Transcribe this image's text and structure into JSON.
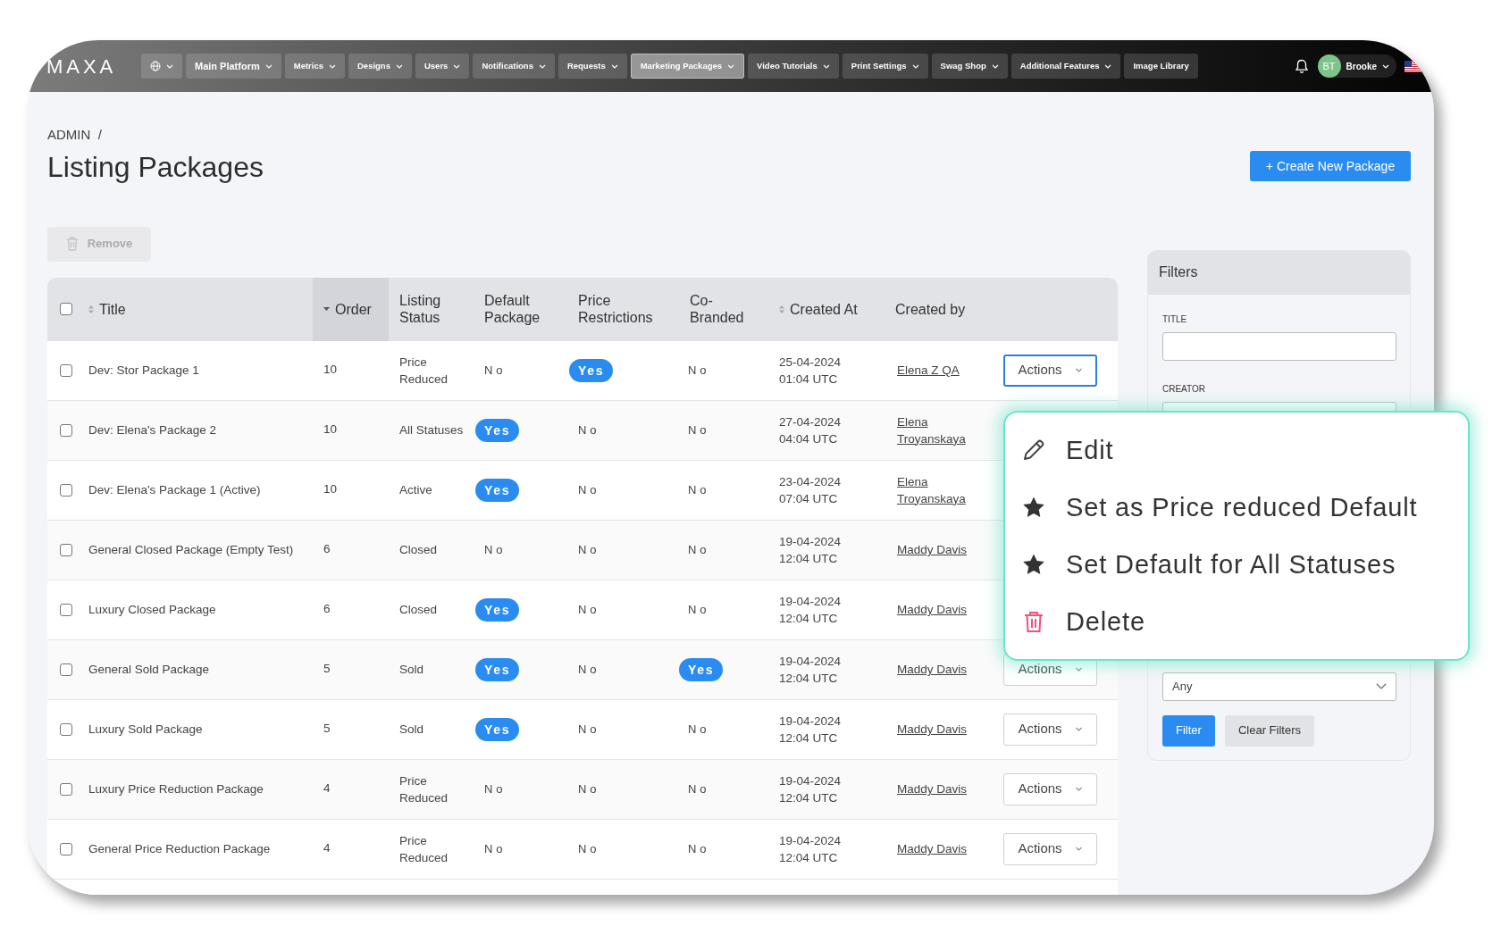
{
  "nav": {
    "logo": "MAXA",
    "items": [
      {
        "kind": "globe",
        "selected": false
      },
      {
        "kind": "menu",
        "label": "Main Platform",
        "selected": false,
        "large": true
      },
      {
        "kind": "menu",
        "label": "Metrics",
        "selected": false
      },
      {
        "kind": "menu",
        "label": "Designs",
        "selected": false
      },
      {
        "kind": "menu",
        "label": "Users",
        "selected": false
      },
      {
        "kind": "menu",
        "label": "Notifications",
        "selected": false
      },
      {
        "kind": "menu",
        "label": "Requests",
        "selected": false
      },
      {
        "kind": "menu",
        "label": "Marketing Packages",
        "selected": true
      },
      {
        "kind": "menu",
        "label": "Video Tutorials",
        "selected": false
      },
      {
        "kind": "menu",
        "label": "Print Settings",
        "selected": false
      },
      {
        "kind": "menu",
        "label": "Swag Shop",
        "selected": false
      },
      {
        "kind": "menu",
        "label": "Additional Features",
        "selected": false
      },
      {
        "kind": "link",
        "label": "Image Library",
        "selected": false
      }
    ],
    "user": {
      "initials": "BT",
      "name": "Brooke"
    }
  },
  "breadcrumb": "ADMIN  /",
  "title": "Listing Packages",
  "create_button": "+ Create New Package",
  "remove_button": {
    "label": "Remove",
    "disabled": true
  },
  "table": {
    "all_checked": false,
    "columns": [
      {
        "label": "Title",
        "sortable": true,
        "sorted": false
      },
      {
        "label": "Order",
        "sortable": true,
        "sorted": true
      },
      {
        "label": "Listing Status",
        "sortable": false,
        "sorted": false
      },
      {
        "label": "Default Package",
        "sortable": false,
        "sorted": false
      },
      {
        "label": "Price Restrictions",
        "sortable": false,
        "sorted": false
      },
      {
        "label": "Co-Branded",
        "sortable": false,
        "sorted": false
      },
      {
        "label": "Created At",
        "sortable": true,
        "sorted": false
      },
      {
        "label": "Created by",
        "sortable": false,
        "sorted": false
      }
    ],
    "rows": [
      {
        "checked": false,
        "title": "Dev: Stor Package 1",
        "order": "10",
        "status": "Price Reduced",
        "default": {
          "text": "No",
          "pill": false
        },
        "price": {
          "text": "Yes",
          "pill": true
        },
        "cobranded": {
          "text": "No",
          "pill": false
        },
        "created_at": "25-04-2024 01:04 UTC",
        "created_by": "Elena Z QA",
        "actions": {
          "label": "Actions",
          "open": true
        }
      },
      {
        "checked": false,
        "title": "Dev: Elena's Package 2",
        "order": "10",
        "status": "All Statuses",
        "default": {
          "text": "Yes",
          "pill": true
        },
        "price": {
          "text": "No",
          "pill": false
        },
        "cobranded": {
          "text": "No",
          "pill": false
        },
        "created_at": "27-04-2024 04:04 UTC",
        "created_by": "Elena Troyanskaya"
      },
      {
        "checked": false,
        "title": "Dev: Elena's Package 1 (Active)",
        "order": "10",
        "status": "Active",
        "default": {
          "text": "Yes",
          "pill": true
        },
        "price": {
          "text": "No",
          "pill": false
        },
        "cobranded": {
          "text": "No",
          "pill": false
        },
        "created_at": "23-04-2024 07:04 UTC",
        "created_by": "Elena Troyanskaya"
      },
      {
        "checked": false,
        "title": "General Closed Package (Empty Test)",
        "order": "6",
        "status": "Closed",
        "default": {
          "text": "No",
          "pill": false
        },
        "price": {
          "text": "No",
          "pill": false
        },
        "cobranded": {
          "text": "No",
          "pill": false
        },
        "created_at": "19-04-2024 12:04 UTC",
        "created_by": "Maddy Davis"
      },
      {
        "checked": false,
        "title": "Luxury Closed Package",
        "order": "6",
        "status": "Closed",
        "default": {
          "text": "Yes",
          "pill": true
        },
        "price": {
          "text": "No",
          "pill": false
        },
        "cobranded": {
          "text": "No",
          "pill": false
        },
        "created_at": "19-04-2024 12:04 UTC",
        "created_by": "Maddy Davis"
      },
      {
        "checked": false,
        "title": "General Sold Package",
        "order": "5",
        "status": "Sold",
        "default": {
          "text": "Yes",
          "pill": true
        },
        "price": {
          "text": "No",
          "pill": false
        },
        "cobranded": {
          "text": "Yes",
          "pill": true
        },
        "created_at": "19-04-2024 12:04 UTC",
        "created_by": "Maddy Davis",
        "actions": {
          "label": "Actions",
          "open": false
        }
      },
      {
        "checked": false,
        "title": "Luxury Sold Package",
        "order": "5",
        "status": "Sold",
        "default": {
          "text": "Yes",
          "pill": true
        },
        "price": {
          "text": "No",
          "pill": false
        },
        "cobranded": {
          "text": "No",
          "pill": false
        },
        "created_at": "19-04-2024 12:04 UTC",
        "created_by": "Maddy Davis",
        "actions": {
          "label": "Actions",
          "open": false
        }
      },
      {
        "checked": false,
        "title": "Luxury Price Reduction Package",
        "order": "4",
        "status": "Price Reduced",
        "default": {
          "text": "No",
          "pill": false
        },
        "price": {
          "text": "No",
          "pill": false
        },
        "cobranded": {
          "text": "No",
          "pill": false
        },
        "created_at": "19-04-2024 12:04 UTC",
        "created_by": "Maddy Davis",
        "actions": {
          "label": "Actions",
          "open": false
        }
      },
      {
        "checked": false,
        "title": "General Price Reduction Package",
        "order": "4",
        "status": "Price Reduced",
        "default": {
          "text": "No",
          "pill": false
        },
        "price": {
          "text": "No",
          "pill": false
        },
        "cobranded": {
          "text": "No",
          "pill": false
        },
        "created_at": "19-04-2024 12:04 UTC",
        "created_by": "Maddy Davis",
        "actions": {
          "label": "Actions",
          "open": false
        }
      }
    ]
  },
  "actions_menu": [
    {
      "kind": "edit",
      "label": "Edit"
    },
    {
      "kind": "star",
      "label": "Set as Price reduced Default"
    },
    {
      "kind": "star",
      "label": "Set Default for All Statuses"
    },
    {
      "kind": "delete",
      "label": "Delete"
    }
  ],
  "filters": {
    "title": "Filters",
    "fields": [
      {
        "kind": "text",
        "label": "TITLE"
      },
      {
        "kind": "text",
        "label": "CREATOR"
      },
      {
        "kind": "select",
        "value": "Any"
      }
    ],
    "buttons": [
      {
        "kind": "primary",
        "label": "Filter"
      },
      {
        "kind": "secondary",
        "label": "Clear Filters"
      }
    ]
  }
}
